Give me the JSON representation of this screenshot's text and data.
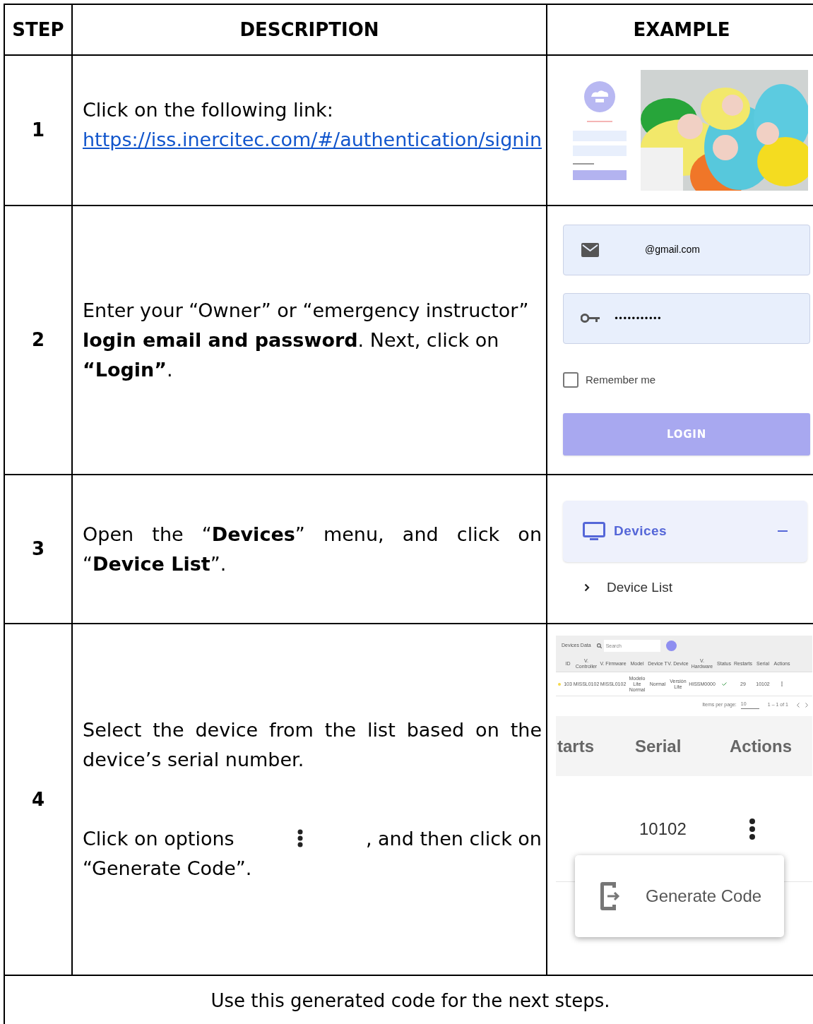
{
  "table": {
    "columns": [
      "STEP",
      "DESCRIPTION",
      "EXAMPLE"
    ],
    "rows": [
      {
        "step": "1",
        "kind": "link",
        "intro": "Click on the following link:",
        "link": "https://iss.inercitec.com/#/authentication/signin",
        "example": {
          "kind": "login_preview"
        }
      },
      {
        "step": "2",
        "kind": "text",
        "paragraphs": [
          "Enter your “Owner” or “emergency instructor” **login email and password**. Next, click on **“Login”**."
        ],
        "example": {
          "kind": "login_form",
          "email": "@gmail.com",
          "password": "•••••••••••",
          "remember": {
            "label": "Remember me",
            "checked": false
          },
          "button": "LOGIN"
        }
      },
      {
        "step": "3",
        "kind": "text",
        "paragraphs": [
          "Open the “**Devices**” menu, and click on “**Device List**”."
        ],
        "example": {
          "kind": "menu",
          "title": "Devices",
          "expanded": true,
          "items": [
            "Device List"
          ]
        }
      },
      {
        "step": "4",
        "kind": "options",
        "paragraphs": [
          "Select the device from the list based on the device’s serial number."
        ],
        "before_icon": "Click on options",
        "after_icon": ", and then click on",
        "continuation": "“Generate Code”.",
        "example": {
          "kind": "device_table",
          "title": "Devices Data",
          "search_placeholder": "Search",
          "columns": [
            "ID",
            "V. Controller",
            "V. Firmware",
            "Model",
            "Device T",
            "V. Device",
            "V. Hardware",
            "Status",
            "Restarts",
            "Serial",
            "Actions"
          ],
          "row": {
            "color": "#f5d94a",
            "cells": [
              "103",
              "MISSL0102",
              "MISSL0102",
              "Modelo Lite Normal",
              "Normal",
              "Versión Lite",
              "HISSM0000",
              "",
              "29",
              "10102"
            ]
          },
          "items_per_page_label": "Items per page:",
          "items_per_page": "10",
          "range": "1 – 1 of 1",
          "zoom_columns": [
            "tarts",
            "Serial",
            "Actions"
          ],
          "zoom_serial": "10102",
          "menu_item": "Generate Code"
        }
      }
    ]
  },
  "footer": "Use this generated code for the next steps."
}
